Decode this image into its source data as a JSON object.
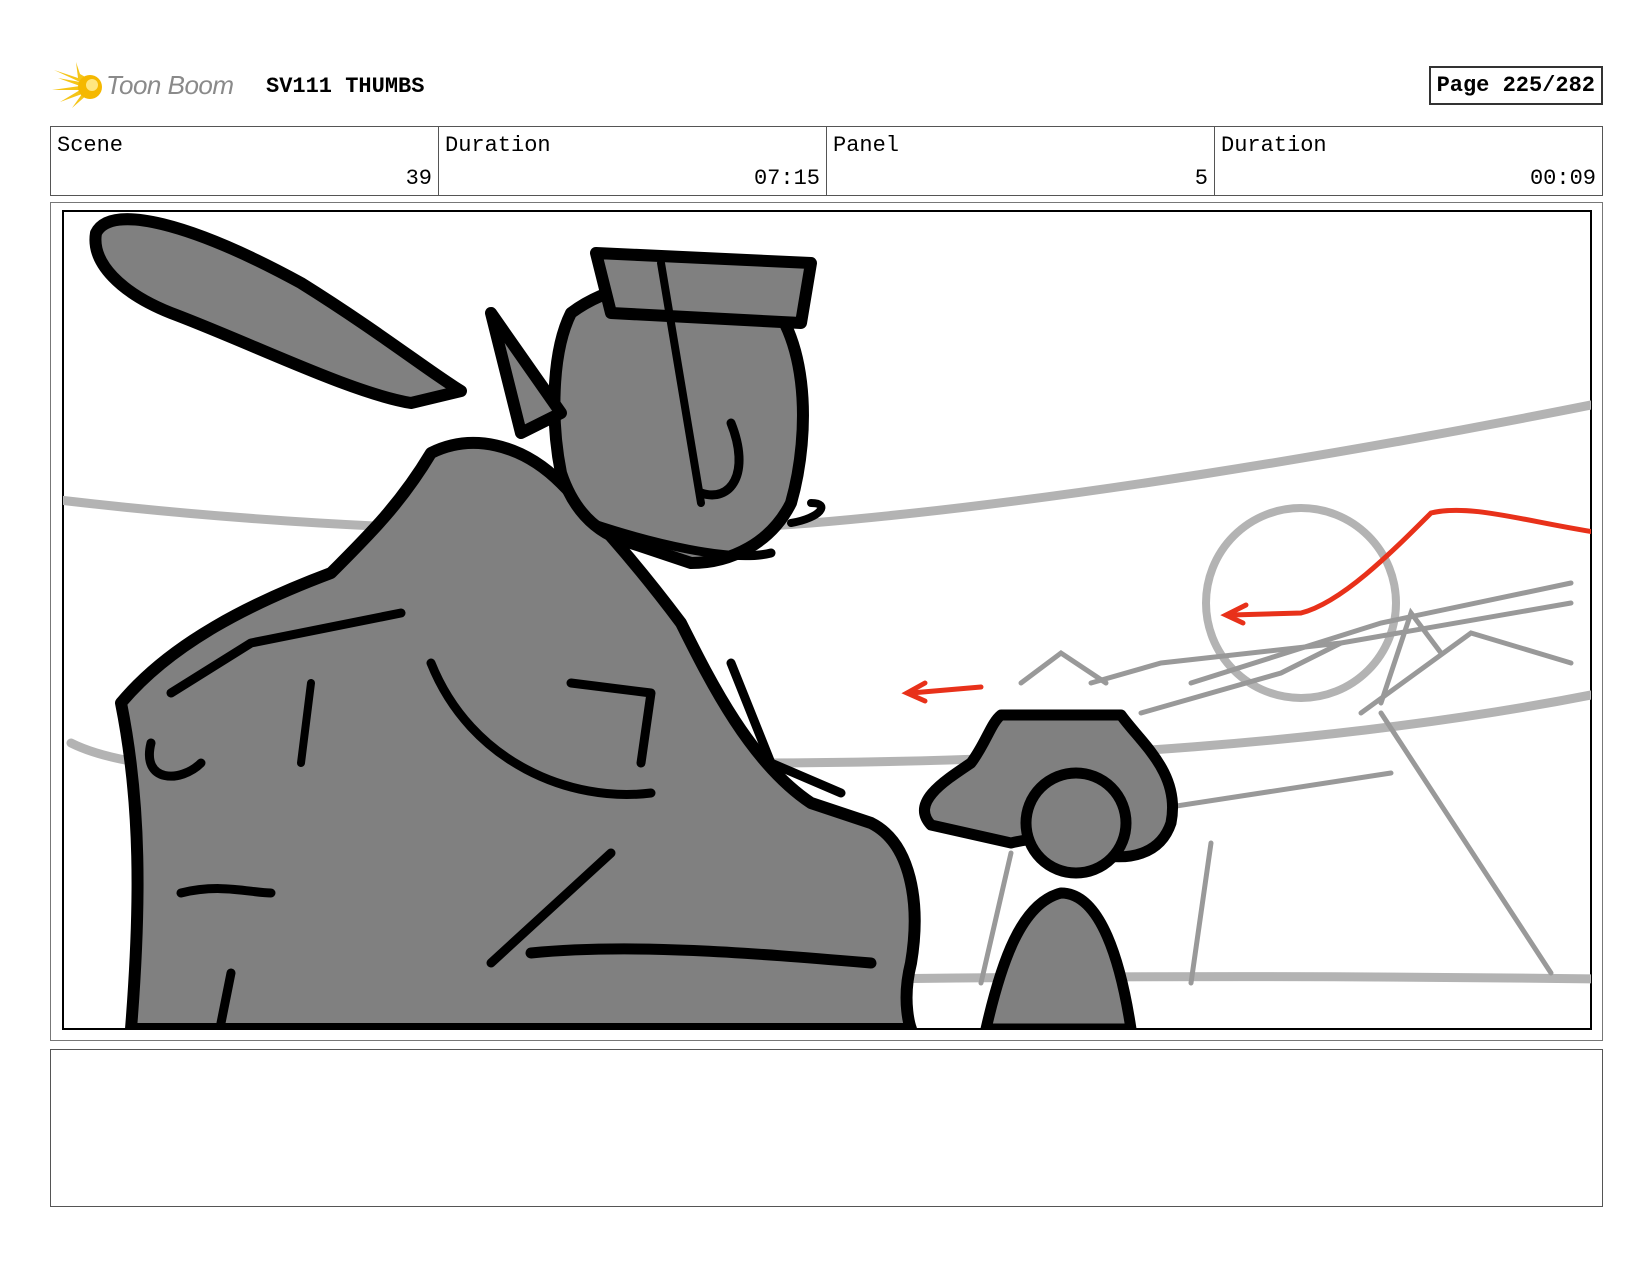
{
  "header": {
    "logo_text": "Toon Boom",
    "title": "SV111 THUMBS",
    "page_label": "Page 225/282"
  },
  "info": [
    {
      "label": "Scene",
      "value": "39"
    },
    {
      "label": "Duration",
      "value": "07:15"
    },
    {
      "label": "Panel",
      "value": "5"
    },
    {
      "label": "Duration",
      "value": "00:09"
    }
  ],
  "colors": {
    "sketch_fill": "#808080",
    "sketch_line": "#000000",
    "background_line": "#b3b3b3",
    "arrow_red": "#e8311a",
    "logo_yellow": "#f5c518"
  },
  "notes": ""
}
